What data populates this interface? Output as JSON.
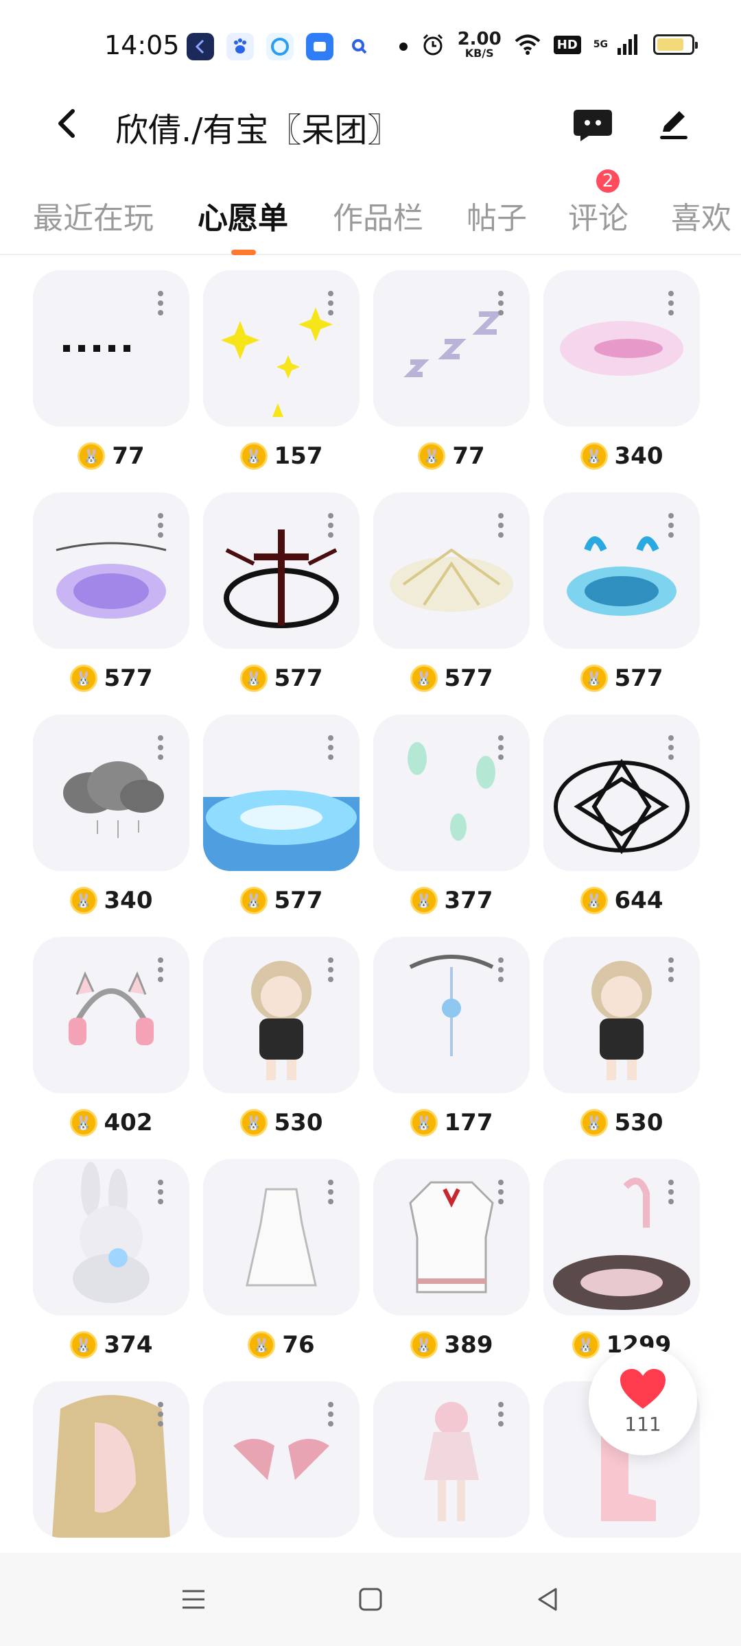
{
  "status_bar": {
    "time": "14:05",
    "net_speed_value": "2.00",
    "net_speed_unit": "KB/S",
    "hd_label": "HD",
    "network_label": "5G",
    "battery_level": 0.8,
    "icons": [
      "alarm-icon",
      "wifi-icon",
      "signal-icon",
      "battery-icon"
    ]
  },
  "header": {
    "title": "欣倩./有宝〖呆团〗",
    "message_badge": "2"
  },
  "tabs": [
    {
      "label": "最近在玩",
      "active": false
    },
    {
      "label": "心愿单",
      "active": true
    },
    {
      "label": "作品栏",
      "active": false
    },
    {
      "label": "帖子",
      "active": false
    },
    {
      "label": "评论",
      "active": false
    },
    {
      "label": "喜欢",
      "active": false
    }
  ],
  "items": [
    {
      "price": "77"
    },
    {
      "price": "157"
    },
    {
      "price": "77"
    },
    {
      "price": "340"
    },
    {
      "price": "577"
    },
    {
      "price": "577"
    },
    {
      "price": "577"
    },
    {
      "price": "577"
    },
    {
      "price": "340"
    },
    {
      "price": "577"
    },
    {
      "price": "377"
    },
    {
      "price": "644"
    },
    {
      "price": "402"
    },
    {
      "price": "530"
    },
    {
      "price": "177"
    },
    {
      "price": "530"
    },
    {
      "price": "374"
    },
    {
      "price": "76"
    },
    {
      "price": "389"
    },
    {
      "price": "1299"
    },
    {
      "price": ""
    },
    {
      "price": ""
    },
    {
      "price": ""
    },
    {
      "price": ""
    }
  ],
  "like_fab": {
    "count": "111"
  },
  "colors": {
    "accent": "#ff7a2e",
    "badge": "#ff4b5c",
    "card_bg": "#f4f3f8",
    "coin": "#f7b500",
    "heart": "#ff3b4e"
  }
}
